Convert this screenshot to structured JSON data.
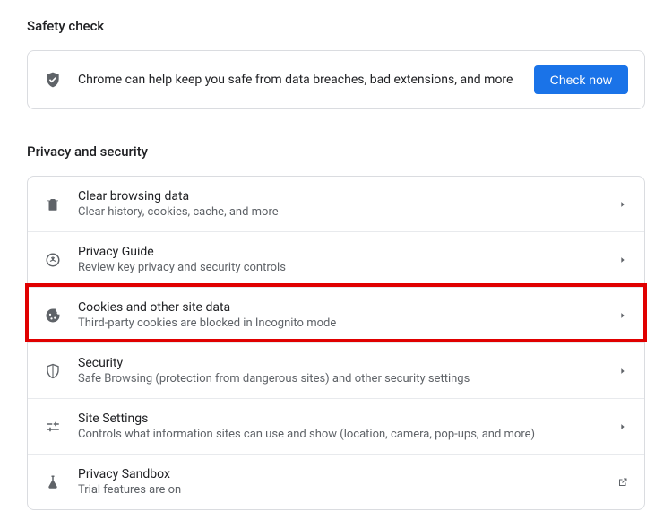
{
  "sections": {
    "safety": {
      "header": "Safety check",
      "text": "Chrome can help keep you safe from data breaches, bad extensions, and more",
      "button": "Check now"
    },
    "privacy": {
      "header": "Privacy and security",
      "items": [
        {
          "title": "Clear browsing data",
          "sub": "Clear history, cookies, cache, and more"
        },
        {
          "title": "Privacy Guide",
          "sub": "Review key privacy and security controls"
        },
        {
          "title": "Cookies and other site data",
          "sub": "Third-party cookies are blocked in Incognito mode"
        },
        {
          "title": "Security",
          "sub": "Safe Browsing (protection from dangerous sites) and other security settings"
        },
        {
          "title": "Site Settings",
          "sub": "Controls what information sites can use and show (location, camera, pop-ups, and more)"
        },
        {
          "title": "Privacy Sandbox",
          "sub": "Trial features are on"
        }
      ]
    }
  }
}
